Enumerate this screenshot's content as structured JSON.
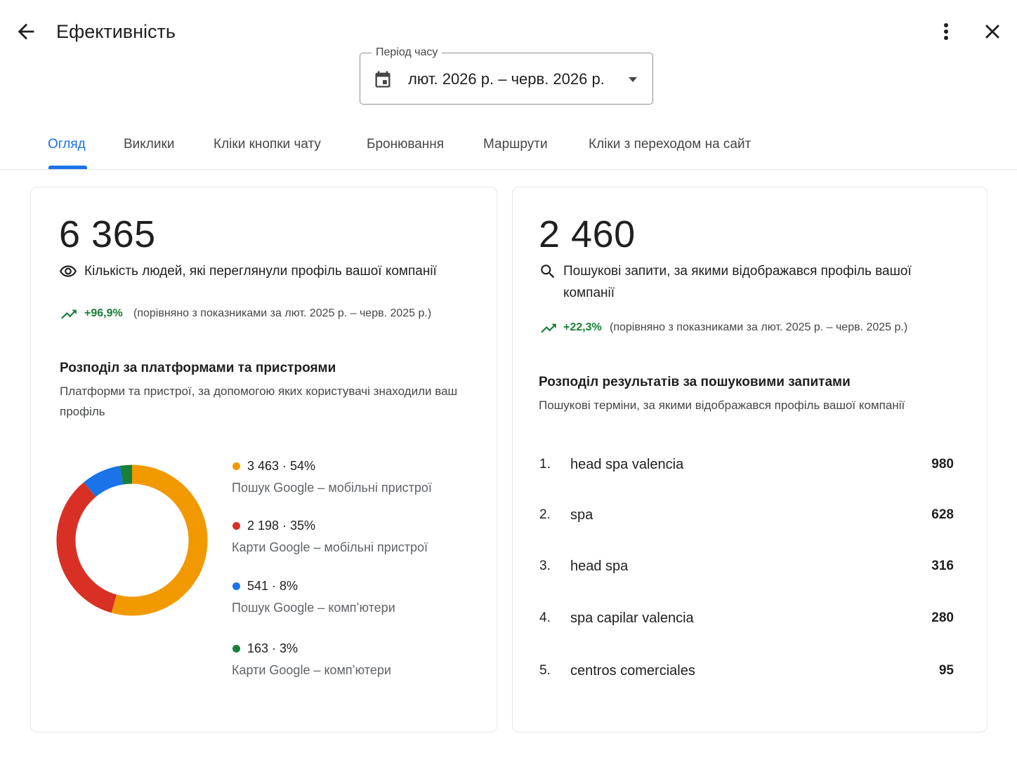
{
  "header": {
    "title": "Ефективність",
    "back_icon": "arrow-back-icon",
    "more_icon": "more-vert-icon",
    "close_icon": "close-icon"
  },
  "period": {
    "label": "Період часу",
    "value": "лют. 2026 р. – черв. 2026 р.",
    "icon": "calendar-icon"
  },
  "tabs": [
    {
      "label": "Огляд",
      "active": true
    },
    {
      "label": "Виклики"
    },
    {
      "label": "Кліки кнопки чату"
    },
    {
      "label": "Бронювання"
    },
    {
      "label": "Маршрути"
    },
    {
      "label": "Кліки з переходом на сайт"
    }
  ],
  "profile_views": {
    "total": "6 365",
    "label": "Кількість людей, які переглянули профіль вашої компанії",
    "change": "+96,9%",
    "compare": "(порівняно з показниками за лют. 2025 р. – черв. 2025 р.)",
    "breakdown_title": "Розподіл за платформами та пристроями",
    "breakdown_subtitle": "Платформи та пристрої, за допомогою яких користувачі знаходили ваш профіль",
    "segments": [
      {
        "value": "3 463 · 54%",
        "label": "Пошук Google – мобільні пристрої",
        "color": "#f29900",
        "count": 3463
      },
      {
        "value": "2 198 · 35%",
        "label": "Карти Google – мобільні пристрої",
        "color": "#d93025",
        "count": 2198
      },
      {
        "value": "541 · 8%",
        "label": "Пошук Google – комп’ютери",
        "color": "#1a73e8",
        "count": 541
      },
      {
        "value": "163 · 3%",
        "label": "Карти Google – комп’ютери",
        "color": "#188038",
        "count": 163
      }
    ]
  },
  "searches": {
    "total": "2 460",
    "label": "Пошукові запити, за якими відображався профіль вашої компанії",
    "change": "+22,3%",
    "compare": "(порівняно з показниками за лют. 2025 р. – черв. 2025 р.)",
    "breakdown_title": "Розподіл результатів за пошуковими запитами",
    "breakdown_subtitle": "Пошукові терміни, за якими відображався профіль вашої компанії",
    "queries": [
      {
        "rank": "1.",
        "term": "head spa valencia",
        "count": "980"
      },
      {
        "rank": "2.",
        "term": "spa",
        "count": "628"
      },
      {
        "rank": "3.",
        "term": "head spa",
        "count": "316"
      },
      {
        "rank": "4.",
        "term": "spa capilar valencia",
        "count": "280"
      },
      {
        "rank": "5.",
        "term": "centros comerciales",
        "count": "95"
      }
    ]
  },
  "colors": {
    "accent": "#1a73e8",
    "positive": "#188038"
  }
}
